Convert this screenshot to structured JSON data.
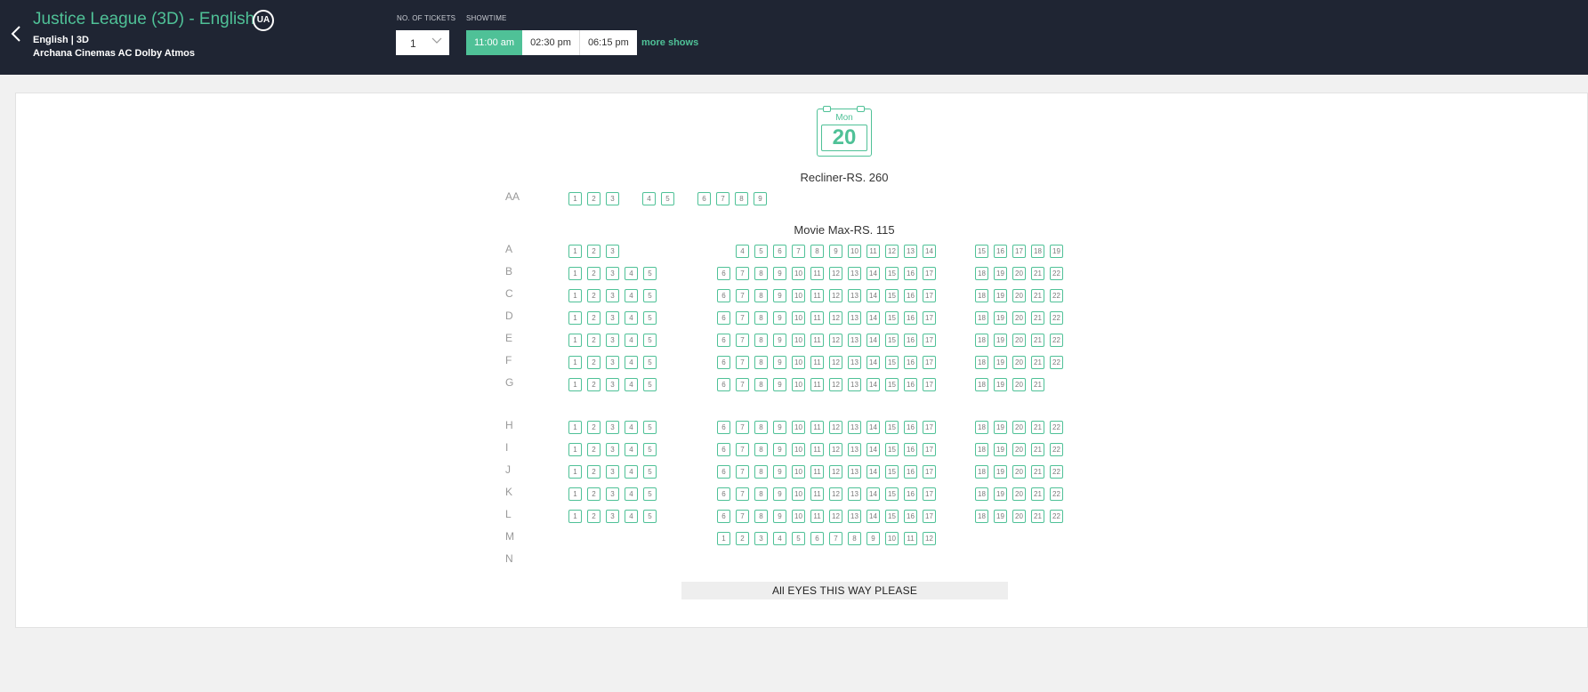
{
  "header": {
    "back_icon": "chevron-left-icon",
    "movie_title": "Justice League (3D) - English",
    "certificate": "UA",
    "format_line": "English | 3D",
    "cinema": "Archana Cinemas AC Dolby Atmos",
    "tickets_label": "NO. OF TICKETS",
    "tickets_value": "1",
    "showtime_label": "SHOWTIME",
    "showtimes": [
      "11:00 am",
      "02:30 pm",
      "06:15 pm"
    ],
    "active_showtime": "11:00 am",
    "more_shows": "more shows"
  },
  "date": {
    "day": "Mon",
    "number": "20"
  },
  "colors": {
    "accent": "#4fc197",
    "header_bg": "#1f2533"
  },
  "sections": [
    {
      "title": "Recliner-RS. 260",
      "rows": [
        {
          "label": "AA",
          "blocks": [
            [
              1,
              2,
              3
            ],
            [
              4,
              5
            ],
            [
              6,
              7,
              8,
              9
            ]
          ]
        }
      ]
    },
    {
      "title": "Movie Max-RS. 115",
      "rows": [
        {
          "label": "A",
          "blocks": [
            [
              1,
              2,
              3
            ],
            [
              4,
              5,
              6,
              7,
              8,
              9,
              10,
              11,
              12,
              13,
              14
            ],
            [
              15,
              16,
              17,
              18,
              19
            ]
          ]
        },
        {
          "label": "B",
          "blocks": [
            [
              1,
              2,
              3,
              4,
              5
            ],
            [
              6,
              7,
              8,
              9,
              10,
              11,
              12,
              13,
              14,
              15,
              16,
              17
            ],
            [
              18,
              19,
              20,
              21,
              22
            ]
          ]
        },
        {
          "label": "C",
          "blocks": [
            [
              1,
              2,
              3,
              4,
              5
            ],
            [
              6,
              7,
              8,
              9,
              10,
              11,
              12,
              13,
              14,
              15,
              16,
              17
            ],
            [
              18,
              19,
              20,
              21,
              22
            ]
          ]
        },
        {
          "label": "D",
          "blocks": [
            [
              1,
              2,
              3,
              4,
              5
            ],
            [
              6,
              7,
              8,
              9,
              10,
              11,
              12,
              13,
              14,
              15,
              16,
              17
            ],
            [
              18,
              19,
              20,
              21,
              22
            ]
          ]
        },
        {
          "label": "E",
          "blocks": [
            [
              1,
              2,
              3,
              4,
              5
            ],
            [
              6,
              7,
              8,
              9,
              10,
              11,
              12,
              13,
              14,
              15,
              16,
              17
            ],
            [
              18,
              19,
              20,
              21,
              22
            ]
          ]
        },
        {
          "label": "F",
          "blocks": [
            [
              1,
              2,
              3,
              4,
              5
            ],
            [
              6,
              7,
              8,
              9,
              10,
              11,
              12,
              13,
              14,
              15,
              16,
              17
            ],
            [
              18,
              19,
              20,
              21,
              22
            ]
          ]
        },
        {
          "label": "G",
          "blocks": [
            [
              1,
              2,
              3,
              4,
              5
            ],
            [
              6,
              7,
              8,
              9,
              10,
              11,
              12,
              13,
              14,
              15,
              16,
              17
            ],
            [
              18,
              19,
              20,
              21
            ]
          ]
        },
        {
          "label": "H",
          "blocks": [
            [
              1,
              2,
              3,
              4,
              5
            ],
            [
              6,
              7,
              8,
              9,
              10,
              11,
              12,
              13,
              14,
              15,
              16,
              17
            ],
            [
              18,
              19,
              20,
              21,
              22
            ]
          ]
        },
        {
          "label": "I",
          "blocks": [
            [
              1,
              2,
              3,
              4,
              5
            ],
            [
              6,
              7,
              8,
              9,
              10,
              11,
              12,
              13,
              14,
              15,
              16,
              17
            ],
            [
              18,
              19,
              20,
              21,
              22
            ]
          ]
        },
        {
          "label": "J",
          "blocks": [
            [
              1,
              2,
              3,
              4,
              5
            ],
            [
              6,
              7,
              8,
              9,
              10,
              11,
              12,
              13,
              14,
              15,
              16,
              17
            ],
            [
              18,
              19,
              20,
              21,
              22
            ]
          ]
        },
        {
          "label": "K",
          "blocks": [
            [
              1,
              2,
              3,
              4,
              5
            ],
            [
              6,
              7,
              8,
              9,
              10,
              11,
              12,
              13,
              14,
              15,
              16,
              17
            ],
            [
              18,
              19,
              20,
              21,
              22
            ]
          ]
        },
        {
          "label": "L",
          "blocks": [
            [
              1,
              2,
              3,
              4,
              5
            ],
            [
              6,
              7,
              8,
              9,
              10,
              11,
              12,
              13,
              14,
              15,
              16,
              17
            ],
            [
              18,
              19,
              20,
              21,
              22
            ]
          ]
        },
        {
          "label": "M",
          "blocks": [
            [],
            [
              1,
              2,
              3,
              4,
              5,
              6,
              7,
              8,
              9,
              10,
              11,
              12
            ],
            []
          ]
        },
        {
          "label": "N",
          "blocks": [
            [],
            [],
            []
          ]
        }
      ]
    }
  ],
  "screen_text": "All EYES THIS WAY PLEASE"
}
